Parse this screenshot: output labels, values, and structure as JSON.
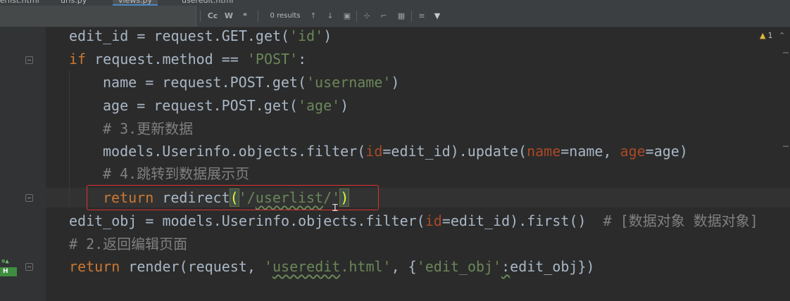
{
  "tabs": [
    {
      "label": "serlist.html"
    },
    {
      "label": "urls.py"
    },
    {
      "label": "views.py"
    },
    {
      "label": "useredit.html"
    }
  ],
  "find_toolbar": {
    "match_case": "Cc",
    "words": "W",
    "regex": "*",
    "results": "0 results"
  },
  "inspection": {
    "warning_count": "1",
    "warning_icon": "warning-triangle-icon"
  },
  "gutter": {
    "badge": "H"
  },
  "code": {
    "l1": [
      "edit_id = request.GET.get(",
      "'id'",
      ")"
    ],
    "l2": [
      "if",
      " request.method == ",
      "'POST'",
      ":"
    ],
    "l3": [
      "name = request.POST.get(",
      "'username'",
      ")"
    ],
    "l4": [
      "age = request.POST.get(",
      "'age'",
      ")"
    ],
    "l5": "# 3.更新数据",
    "l6": [
      "models.Userinfo.objects.filter(",
      "id",
      "=edit_id).update(",
      "name",
      "=name, ",
      "age",
      "=age)"
    ],
    "l7": "# 4.跳转到数据展示页",
    "l8": [
      "return",
      " redirect",
      "(",
      "'/",
      "userlist",
      "/'",
      ")"
    ],
    "l9": [
      "edit_obj = models.Userinfo.objects.filter(",
      "id",
      "=edit_id).first()  ",
      "# [数据对象 数据对象]"
    ],
    "l10": "# 2.返回编辑页面",
    "l11": [
      "return",
      " render(request, ",
      "'",
      "useredit",
      ".html'",
      ", {",
      "'edit_obj'",
      ":",
      "edit_obj})"
    ]
  },
  "colors": {
    "keyword": "#cc7832",
    "string": "#6a8759",
    "comment": "#808080",
    "param": "#aa4926",
    "text": "#a9b7c6",
    "annotation_box": "#e03030"
  }
}
